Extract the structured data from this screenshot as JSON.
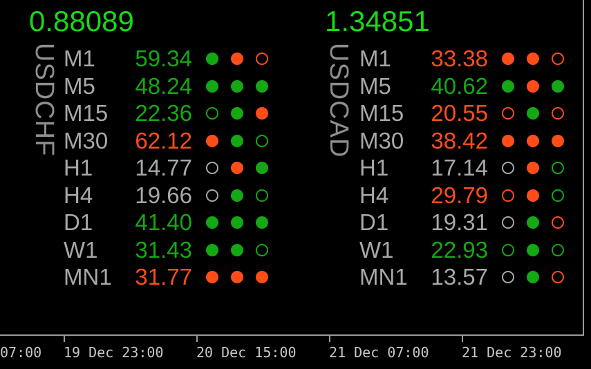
{
  "colors": {
    "green": "#14a814",
    "bright_green": "#18d918",
    "red": "#ff4d1a",
    "gray": "#a8a8a8",
    "hollow_gray": "#a8a8a8"
  },
  "panels": [
    {
      "price": "0.88089",
      "symbol": "USDCHF",
      "rows": [
        {
          "tf": "M1",
          "value": "59.34",
          "value_color": "green",
          "dots": [
            [
              "filled",
              "green"
            ],
            [
              "filled",
              "red"
            ],
            [
              "hollow",
              "red"
            ]
          ]
        },
        {
          "tf": "M5",
          "value": "48.24",
          "value_color": "green",
          "dots": [
            [
              "filled",
              "green"
            ],
            [
              "filled",
              "green"
            ],
            [
              "filled",
              "green"
            ]
          ]
        },
        {
          "tf": "M15",
          "value": "22.36",
          "value_color": "green",
          "dots": [
            [
              "hollow",
              "green"
            ],
            [
              "filled",
              "green"
            ],
            [
              "filled",
              "red"
            ]
          ]
        },
        {
          "tf": "M30",
          "value": "62.12",
          "value_color": "red",
          "dots": [
            [
              "filled",
              "red"
            ],
            [
              "filled",
              "green"
            ],
            [
              "hollow",
              "green"
            ]
          ]
        },
        {
          "tf": "H1",
          "value": "14.77",
          "value_color": "gray",
          "dots": [
            [
              "hollow",
              "gray"
            ],
            [
              "filled",
              "red"
            ],
            [
              "filled",
              "green"
            ]
          ]
        },
        {
          "tf": "H4",
          "value": "19.66",
          "value_color": "gray",
          "dots": [
            [
              "hollow",
              "gray"
            ],
            [
              "filled",
              "green"
            ],
            [
              "hollow",
              "green"
            ]
          ]
        },
        {
          "tf": "D1",
          "value": "41.40",
          "value_color": "green",
          "dots": [
            [
              "filled",
              "green"
            ],
            [
              "filled",
              "green"
            ],
            [
              "filled",
              "green"
            ]
          ]
        },
        {
          "tf": "W1",
          "value": "31.43",
          "value_color": "green",
          "dots": [
            [
              "filled",
              "green"
            ],
            [
              "filled",
              "green"
            ],
            [
              "hollow",
              "green"
            ]
          ]
        },
        {
          "tf": "MN1",
          "value": "31.77",
          "value_color": "red",
          "dots": [
            [
              "filled",
              "red"
            ],
            [
              "filled",
              "red"
            ],
            [
              "filled",
              "red"
            ]
          ]
        }
      ]
    },
    {
      "price": "1.34851",
      "symbol": "USDCAD",
      "rows": [
        {
          "tf": "M1",
          "value": "33.38",
          "value_color": "red",
          "dots": [
            [
              "filled",
              "red"
            ],
            [
              "filled",
              "red"
            ],
            [
              "hollow",
              "red"
            ]
          ]
        },
        {
          "tf": "M5",
          "value": "40.62",
          "value_color": "green",
          "dots": [
            [
              "filled",
              "green"
            ],
            [
              "filled",
              "red"
            ],
            [
              "filled",
              "green"
            ]
          ]
        },
        {
          "tf": "M15",
          "value": "20.55",
          "value_color": "red",
          "dots": [
            [
              "hollow",
              "red"
            ],
            [
              "filled",
              "green"
            ],
            [
              "hollow",
              "red"
            ]
          ]
        },
        {
          "tf": "M30",
          "value": "38.42",
          "value_color": "red",
          "dots": [
            [
              "filled",
              "red"
            ],
            [
              "filled",
              "red"
            ],
            [
              "filled",
              "red"
            ]
          ]
        },
        {
          "tf": "H1",
          "value": "17.14",
          "value_color": "gray",
          "dots": [
            [
              "hollow",
              "gray"
            ],
            [
              "filled",
              "red"
            ],
            [
              "hollow",
              "green"
            ]
          ]
        },
        {
          "tf": "H4",
          "value": "29.79",
          "value_color": "red",
          "dots": [
            [
              "hollow",
              "red"
            ],
            [
              "filled",
              "red"
            ],
            [
              "hollow",
              "green"
            ]
          ]
        },
        {
          "tf": "D1",
          "value": "19.31",
          "value_color": "gray",
          "dots": [
            [
              "hollow",
              "gray"
            ],
            [
              "filled",
              "green"
            ],
            [
              "hollow",
              "red"
            ]
          ]
        },
        {
          "tf": "W1",
          "value": "22.93",
          "value_color": "green",
          "dots": [
            [
              "hollow",
              "green"
            ],
            [
              "filled",
              "green"
            ],
            [
              "hollow",
              "green"
            ]
          ]
        },
        {
          "tf": "MN1",
          "value": "13.57",
          "value_color": "gray",
          "dots": [
            [
              "hollow",
              "gray"
            ],
            [
              "filled",
              "green"
            ],
            [
              "hollow",
              "red"
            ]
          ]
        }
      ]
    }
  ],
  "time_axis": {
    "labels": [
      "07:00",
      "19 Dec 23:00",
      "20 Dec 15:00",
      "21 Dec 07:00",
      "21 Dec 23:00"
    ]
  }
}
